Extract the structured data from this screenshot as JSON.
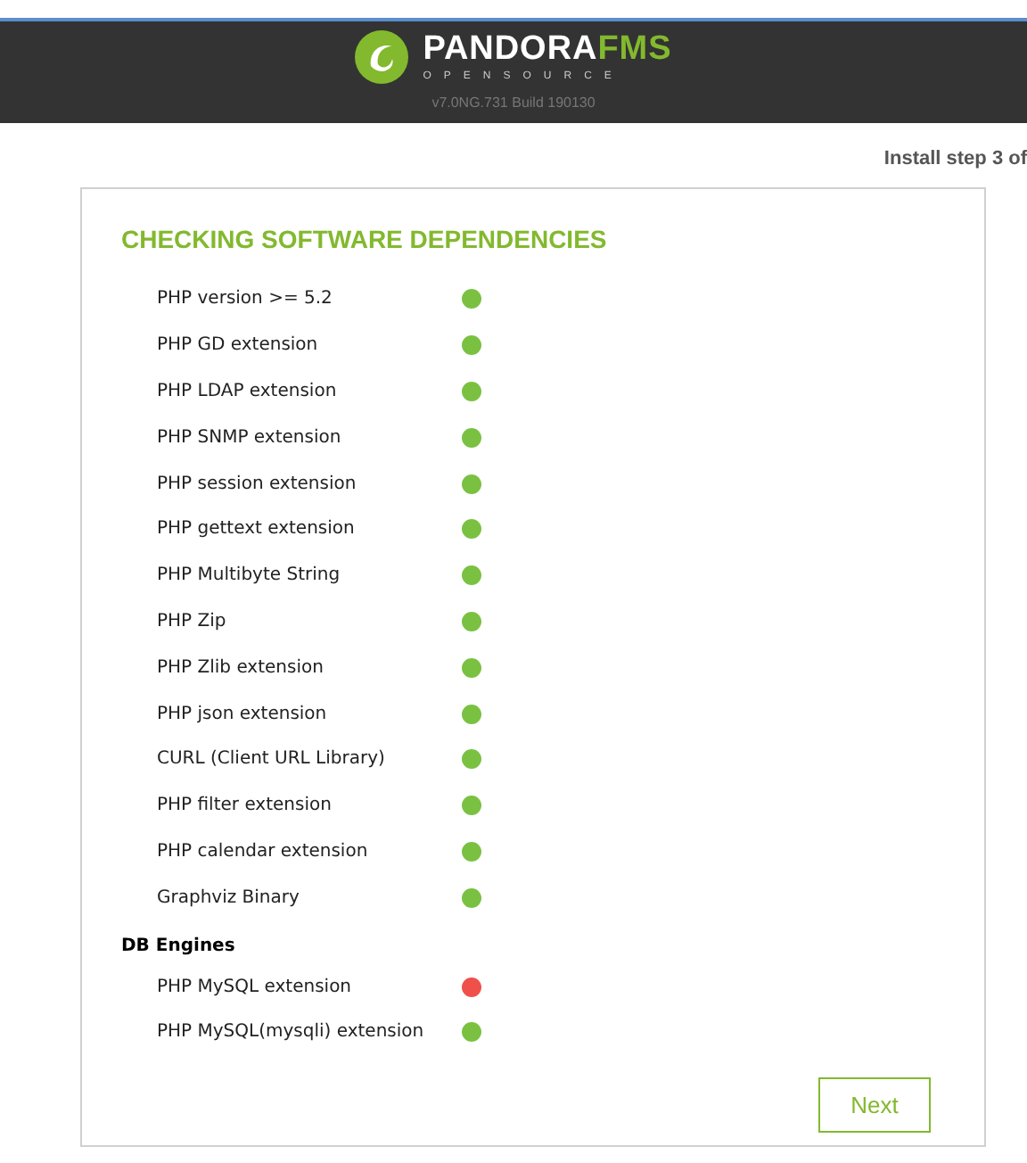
{
  "header": {
    "brand": "PANDORA",
    "brand_accent": "FMS",
    "tagline": "OPENSOURCE",
    "version": "v7.0NG.731 Build 190130"
  },
  "step": "Install step 3 of",
  "title": "CHECKING SOFTWARE DEPENDENCIES",
  "checks": [
    {
      "kind": "check",
      "label": "PHP version >= 5.2",
      "ok": true
    },
    {
      "kind": "check",
      "label": "PHP GD extension",
      "ok": true
    },
    {
      "kind": "check",
      "label": "PHP LDAP extension",
      "ok": true
    },
    {
      "kind": "check",
      "label": "PHP SNMP extension",
      "ok": true
    },
    {
      "kind": "check",
      "label": "PHP session extension",
      "ok": true
    },
    {
      "kind": "check",
      "label": "PHP gettext extension",
      "ok": true
    },
    {
      "kind": "check",
      "label": "PHP Multibyte String",
      "ok": true
    },
    {
      "kind": "check",
      "label": "PHP Zip",
      "ok": true
    },
    {
      "kind": "check",
      "label": "PHP Zlib extension",
      "ok": true
    },
    {
      "kind": "check",
      "label": "PHP json extension",
      "ok": true
    },
    {
      "kind": "check",
      "label": "CURL (Client URL Library)",
      "ok": true
    },
    {
      "kind": "check",
      "label": "PHP filter extension",
      "ok": true
    },
    {
      "kind": "check",
      "label": "PHP calendar extension",
      "ok": true
    },
    {
      "kind": "check",
      "label": "Graphviz Binary",
      "ok": true
    },
    {
      "kind": "section",
      "label": "DB Engines"
    },
    {
      "kind": "check",
      "label": "PHP MySQL extension",
      "ok": false
    },
    {
      "kind": "check",
      "label": "PHP MySQL(mysqli) extension",
      "ok": true
    }
  ],
  "next_button": "Next"
}
